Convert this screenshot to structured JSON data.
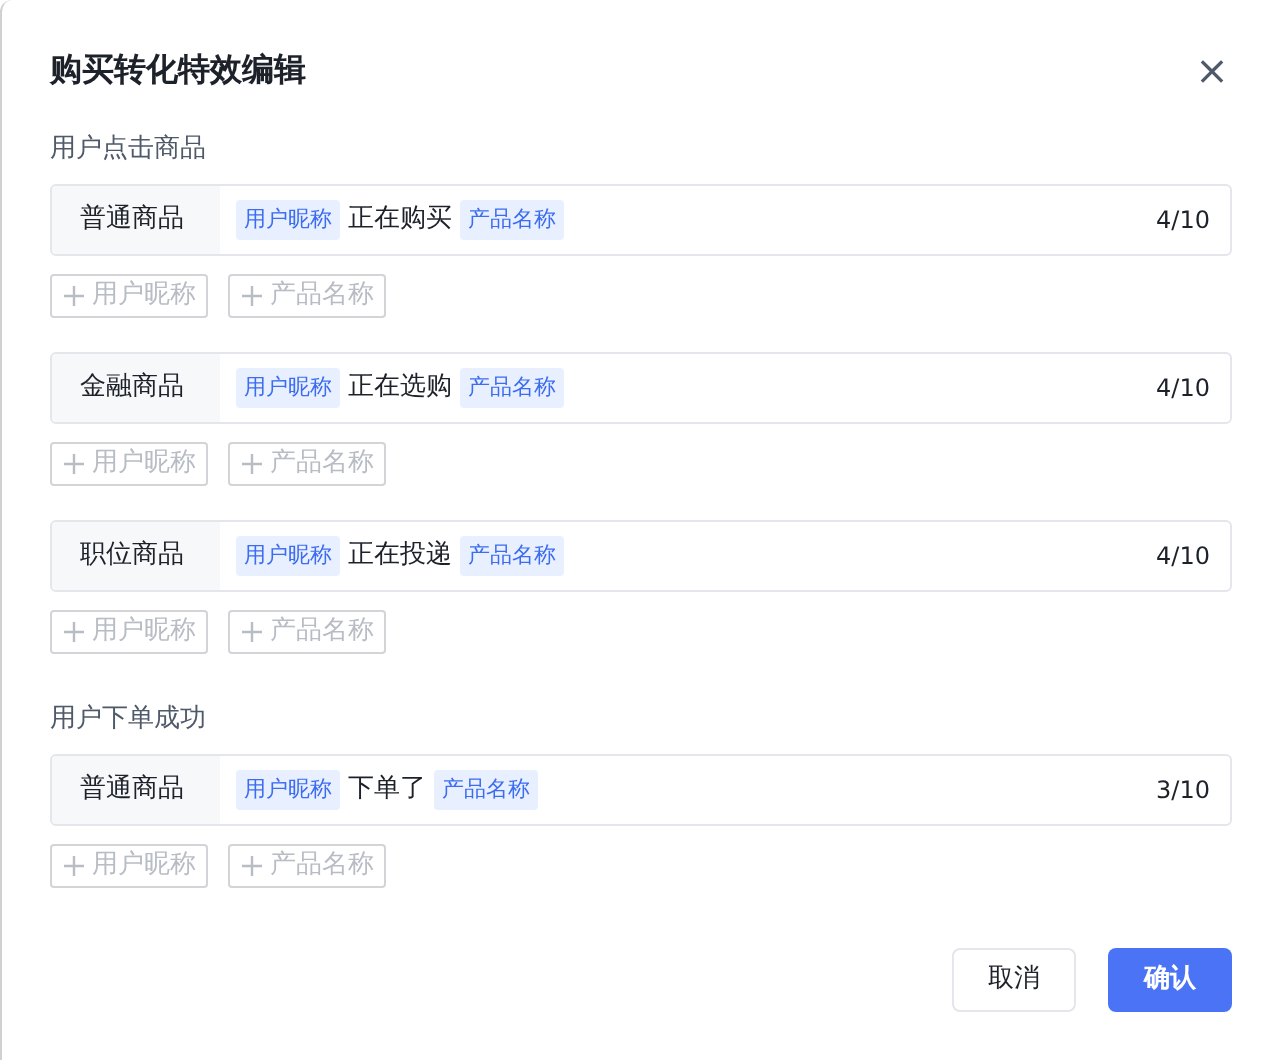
{
  "dialog": {
    "title": "购买转化特效编辑",
    "close": "×"
  },
  "sections": [
    {
      "label": "用户点击商品",
      "rows": [
        {
          "category": "普通商品",
          "tokens": [
            {
              "kind": "tag",
              "text": "用户昵称"
            },
            {
              "kind": "text",
              "text": "正在购买"
            },
            {
              "kind": "tag",
              "text": "产品名称"
            }
          ],
          "count": "4/10",
          "add_buttons": [
            {
              "label": "用户昵称",
              "disabled": true
            },
            {
              "label": "产品名称",
              "disabled": true
            }
          ]
        },
        {
          "category": "金融商品",
          "tokens": [
            {
              "kind": "tag",
              "text": "用户昵称"
            },
            {
              "kind": "text",
              "text": "正在选购"
            },
            {
              "kind": "tag",
              "text": "产品名称"
            }
          ],
          "count": "4/10",
          "add_buttons": [
            {
              "label": "用户昵称",
              "disabled": true
            },
            {
              "label": "产品名称",
              "disabled": true
            }
          ]
        },
        {
          "category": "职位商品",
          "tokens": [
            {
              "kind": "tag",
              "text": "用户昵称"
            },
            {
              "kind": "text",
              "text": "正在投递"
            },
            {
              "kind": "tag",
              "text": "产品名称"
            }
          ],
          "count": "4/10",
          "add_buttons": [
            {
              "label": "用户昵称",
              "disabled": true
            },
            {
              "label": "产品名称",
              "disabled": true
            }
          ]
        }
      ]
    },
    {
      "label": "用户下单成功",
      "rows": [
        {
          "category": "普通商品",
          "tokens": [
            {
              "kind": "tag",
              "text": "用户昵称"
            },
            {
              "kind": "text",
              "text": "下单了"
            },
            {
              "kind": "tag",
              "text": "产品名称"
            }
          ],
          "count": "3/10",
          "add_buttons": [
            {
              "label": "用户昵称",
              "disabled": true
            },
            {
              "label": "产品名称",
              "disabled": true
            }
          ]
        }
      ]
    }
  ],
  "footer": {
    "buttons": [
      {
        "label": "取消",
        "kind": "secondary"
      },
      {
        "label": "确认",
        "kind": "primary"
      }
    ]
  }
}
